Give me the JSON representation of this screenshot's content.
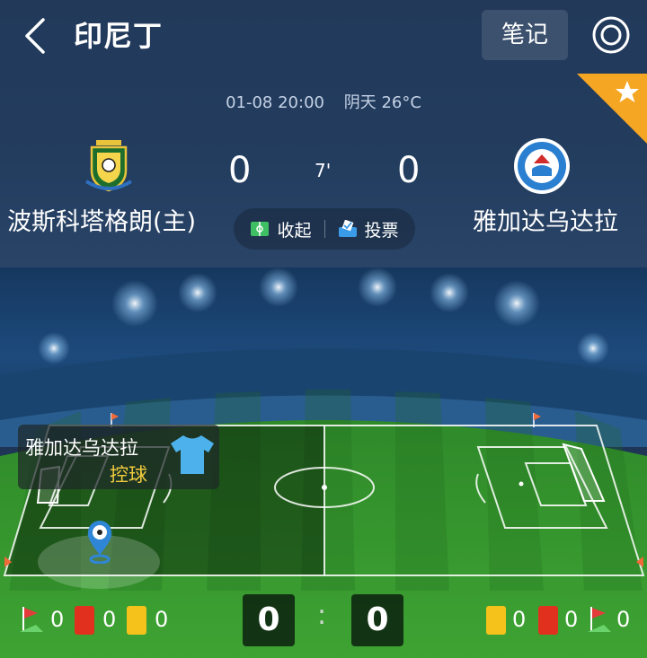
{
  "header": {
    "title": "印尼丁",
    "notes_label": "笔记",
    "back_icon": "chevron-left-icon",
    "target_icon": "target-icon",
    "favorite_icon": "star-icon",
    "favorite_color": "#f5a623"
  },
  "match": {
    "datetime": "01-08 20:00",
    "weather": "阴天 26°C",
    "minute": "7'",
    "home": {
      "name": "波斯科塔格朗(主)",
      "score": "0",
      "logo": "persikota-crest"
    },
    "away": {
      "name": "雅加达乌达拉",
      "score": "0",
      "logo": "persitara-crest"
    },
    "actions": {
      "collapse_label": "收起",
      "vote_label": "投票"
    }
  },
  "pitch": {
    "possession_team": "雅加达乌达拉",
    "possession_status": "控球",
    "possession_color": "#f3cc3d",
    "shirt_color": "#4db2ec"
  },
  "stats": {
    "home": {
      "corners": "0",
      "red_cards": "0",
      "yellow_cards": "0"
    },
    "away": {
      "yellow_cards": "0",
      "red_cards": "0",
      "corners": "0"
    },
    "score_home": "0",
    "score_away": "0",
    "separator": ":"
  }
}
